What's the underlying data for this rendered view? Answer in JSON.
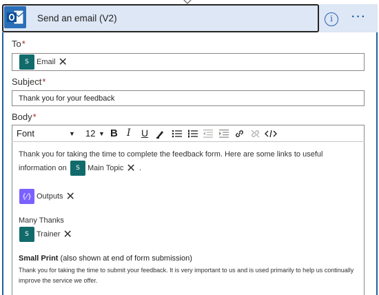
{
  "action": {
    "title": "Send an email (V2)",
    "app_icon": "outlook-icon",
    "info_icon": "info-icon",
    "more_icon": "more-options-icon"
  },
  "to": {
    "label": "To",
    "required_mark": "*",
    "tokens": [
      {
        "label": "Email",
        "icon": "sharepoint-icon"
      }
    ]
  },
  "subject": {
    "label": "Subject",
    "required_mark": "*",
    "value": "Thank you for your feedback"
  },
  "body": {
    "label": "Body",
    "required_mark": "*",
    "toolbar": {
      "font": "Font",
      "size": "12",
      "bold": "B",
      "italic": "I",
      "underline": "U"
    },
    "paragraph1": "Thank you for taking the time to complete the feedback form.  Here are some links to useful",
    "paragraph1b": "information on",
    "paragraph1_end": ".",
    "main_topic_token": "Main Topic",
    "outputs_token": "Outputs",
    "closing": "Many Thanks",
    "trainer_token": "Trainer",
    "small_print_title": "Small Print",
    "small_print_note": " (also shown at end of form submission)",
    "small_print_body": "Thank you for taking the time to submit your feedback.  It is very important to us and is used primarily to help us continually improve the service we offer."
  },
  "colors": {
    "header_bg": "#dde7f5",
    "accent": "#2a5fb0",
    "sharepoint_token": "#126b6b",
    "outputs_token": "#7b61ff",
    "required": "#a4262c"
  }
}
